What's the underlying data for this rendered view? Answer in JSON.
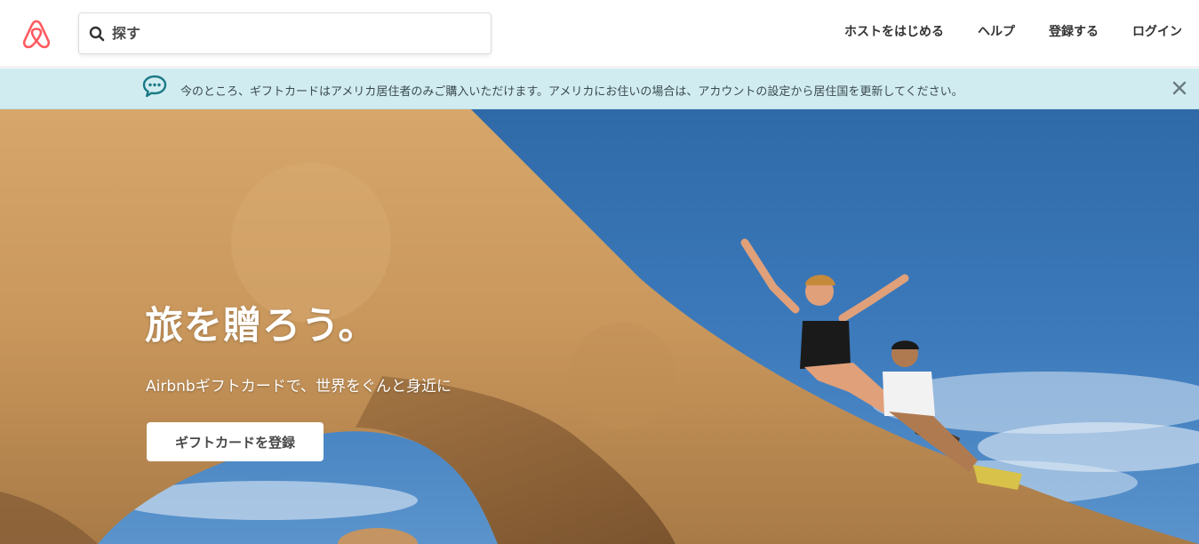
{
  "header": {
    "logo_icon": "airbnb-logo-icon",
    "search": {
      "placeholder": "探す",
      "icon": "search-icon"
    },
    "nav": [
      {
        "label": "ホストをはじめる"
      },
      {
        "label": "ヘルプ"
      },
      {
        "label": "登録する"
      },
      {
        "label": "ログイン"
      }
    ]
  },
  "banner": {
    "icon": "chat-bubble-icon",
    "message": "今のところ、ギフトカードはアメリカ居住者のみご購入いただけます。アメリカにお住いの場合は、アカウントの設定から居住国を更新してください。",
    "close_icon": "close-icon",
    "background_color": "#d1ecf1"
  },
  "hero": {
    "title": "旅を贈ろう。",
    "subtitle": "Airbnbギフトカードで、世界をぐんと身近に",
    "button_label": "ギフトカードを登録"
  },
  "colors": {
    "brand": "#ff5a5f",
    "banner_icon": "#1a7a85"
  }
}
